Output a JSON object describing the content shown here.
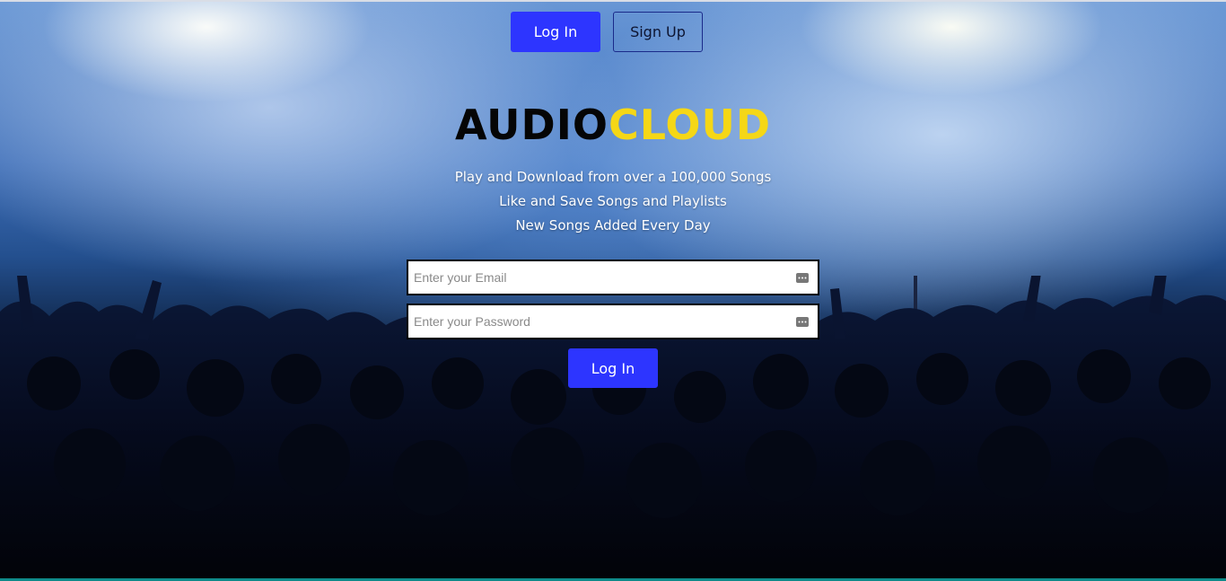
{
  "header": {
    "login_label": "Log In",
    "signup_label": "Sign Up"
  },
  "brand": {
    "part1": "AUDIO",
    "part2": "CLOUD"
  },
  "taglines": [
    "Play and Download from over a 100,000 Songs",
    "Like and Save Songs and Playlists",
    "New Songs Added Every Day"
  ],
  "form": {
    "email_placeholder": "Enter your Email",
    "password_placeholder": "Enter your Password",
    "submit_label": "Log In"
  },
  "colors": {
    "accent": "#2d35ff",
    "brand_yellow": "#f5d716"
  }
}
